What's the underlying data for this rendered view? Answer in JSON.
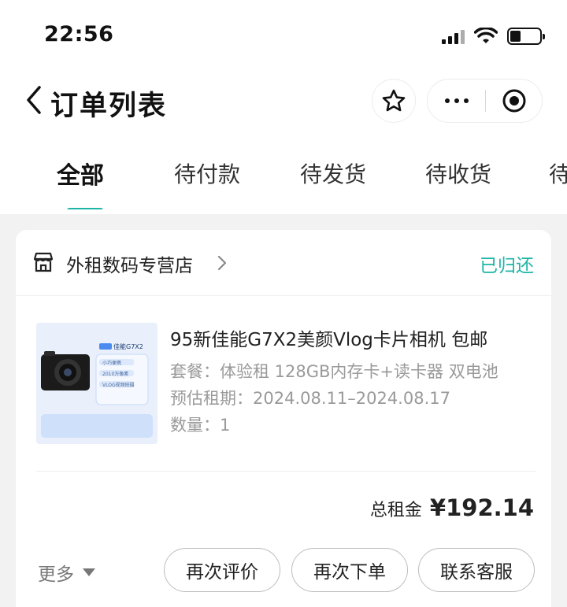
{
  "status_bar": {
    "time": "22:56"
  },
  "nav": {
    "title": "订单列表"
  },
  "tabs": [
    {
      "label": "全部",
      "active": true
    },
    {
      "label": "待付款"
    },
    {
      "label": "待发货"
    },
    {
      "label": "待收货"
    },
    {
      "label": "待"
    }
  ],
  "order": {
    "shop_name": "外租数码专营店",
    "status": "已归还",
    "product": {
      "title": "95新佳能G7X2美颜Vlog卡片相机 包邮",
      "package": "套餐：体验租 128GB内存卡+读卡器 双电池",
      "rental_period": "预估租期：2024.08.11–2024.08.17",
      "quantity": "数量：1",
      "image": {
        "model_badge": "佳能G7X2",
        "features": [
          "小巧便携",
          "2010万像素",
          "VLOG视频拍摄"
        ]
      }
    },
    "total_label": "总租金",
    "total_value": "¥192.14",
    "more_label": "更多",
    "actions": [
      "再次评价",
      "再次下单",
      "联系客服"
    ]
  },
  "colors": {
    "accent": "#1fb5a6",
    "background": "#f2f2f2",
    "card": "#ffffff"
  }
}
